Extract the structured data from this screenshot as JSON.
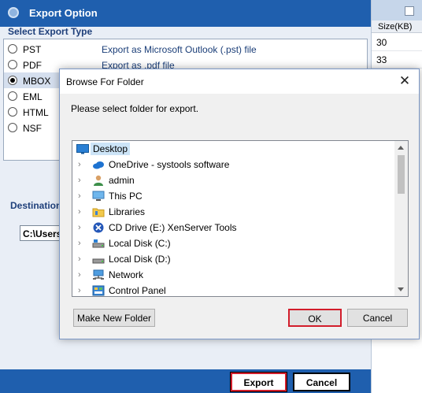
{
  "app": {
    "title": "Export Option"
  },
  "export_types": {
    "section_label": "Select Export Type",
    "items": [
      {
        "name": "PST",
        "desc": "Export as Microsoft Outlook (.pst) file",
        "selected": false
      },
      {
        "name": "PDF",
        "desc": "Export as .pdf file",
        "selected": false
      },
      {
        "name": "MBOX",
        "desc": "",
        "selected": true
      },
      {
        "name": "EML",
        "desc": "",
        "selected": false
      },
      {
        "name": "HTML",
        "desc": "",
        "selected": false
      },
      {
        "name": "NSF",
        "desc": "",
        "selected": false
      }
    ]
  },
  "destination": {
    "label": "Destination",
    "path": "C:\\Users\\"
  },
  "right_column": {
    "header": "Size(KB)",
    "values": [
      "30",
      "33"
    ]
  },
  "footer": {
    "export_label": "Export",
    "cancel_label": "Cancel"
  },
  "dialog": {
    "title": "Browse For Folder",
    "close_glyph": "✕",
    "prompt": "Please select folder for export.",
    "tree": [
      {
        "label": "Desktop",
        "icon": "desktop-icon",
        "expandable": false,
        "highlight": true
      },
      {
        "label": "OneDrive - systools software",
        "icon": "cloud-icon",
        "expandable": true,
        "highlight": false
      },
      {
        "label": "admin",
        "icon": "user-icon",
        "expandable": true,
        "highlight": false
      },
      {
        "label": "This PC",
        "icon": "computer-icon",
        "expandable": true,
        "highlight": false
      },
      {
        "label": "Libraries",
        "icon": "folder-icon",
        "expandable": true,
        "highlight": false
      },
      {
        "label": "CD Drive (E:) XenServer Tools",
        "icon": "cd-drive-icon",
        "expandable": true,
        "highlight": false
      },
      {
        "label": "Local Disk (C:)",
        "icon": "disk-icon",
        "expandable": true,
        "highlight": false
      },
      {
        "label": "Local Disk (D:)",
        "icon": "disk-icon",
        "expandable": true,
        "highlight": false
      },
      {
        "label": "Network",
        "icon": "network-icon",
        "expandable": true,
        "highlight": false
      },
      {
        "label": "Control Panel",
        "icon": "control-panel-icon",
        "expandable": true,
        "highlight": false
      }
    ],
    "buttons": {
      "make_new_folder": "Make New Folder",
      "ok": "OK",
      "cancel": "Cancel"
    }
  },
  "colors": {
    "title_bar": "#1f5fae",
    "accent_red": "#d21d2b",
    "selection": "#cce4f7"
  }
}
